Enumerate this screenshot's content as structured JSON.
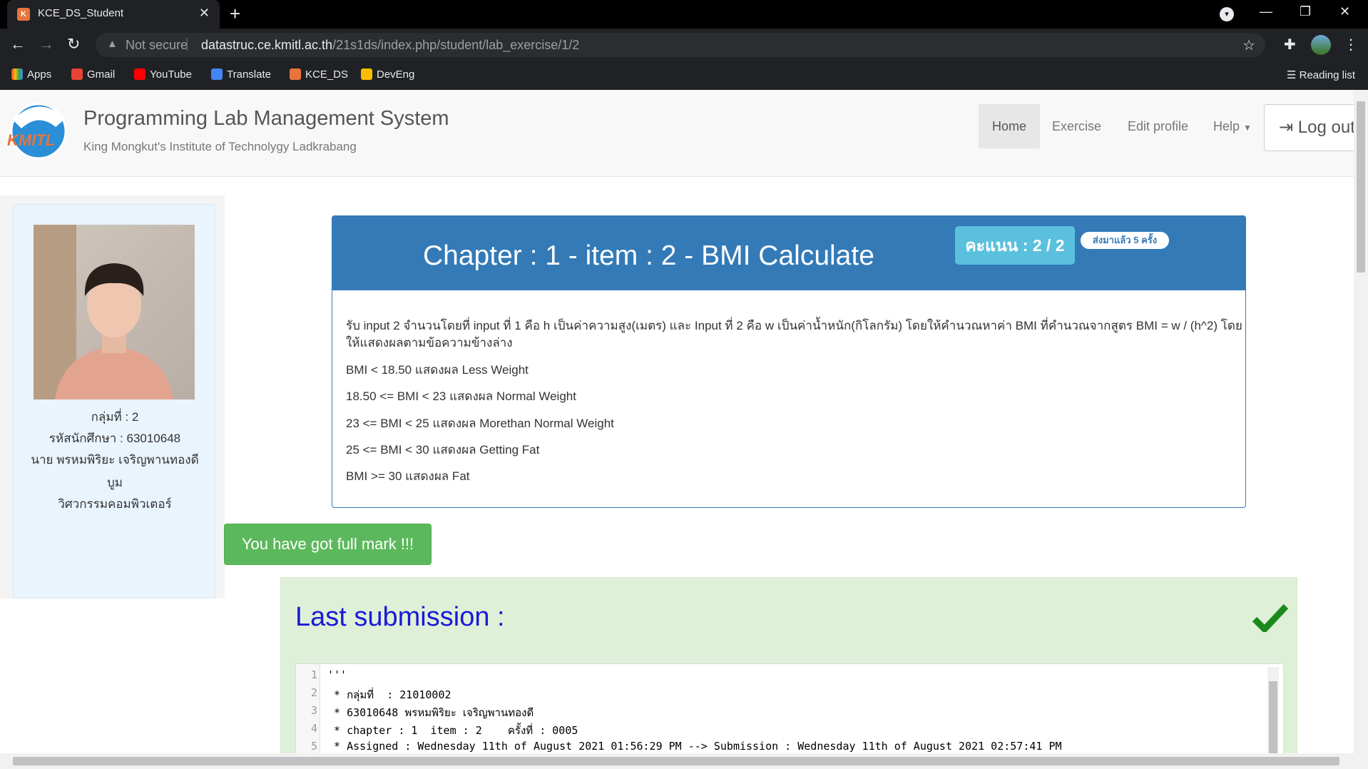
{
  "browser": {
    "tab_title": "KCE_DS_Student",
    "tab_favicon_text": "K",
    "url_security": "Not secure",
    "url_host": "datastruc.ce.kmitl.ac.th",
    "url_path": "/21s1ds/index.php/student/lab_exercise/1/2",
    "bookmarks": [
      {
        "label": "Apps",
        "color": "#ea4335"
      },
      {
        "label": "Gmail",
        "color": "#ea4335"
      },
      {
        "label": "YouTube",
        "color": "#ff0000"
      },
      {
        "label": "Translate",
        "color": "#4285f4"
      },
      {
        "label": "KCE_DS",
        "color": "#e8743b"
      },
      {
        "label": "DevEng",
        "color": "#fbbc04"
      }
    ],
    "reading_list": "Reading list"
  },
  "header": {
    "title": "Programming Lab Management System",
    "subtitle": "King Mongkut's Institute of Technolygy Ladkrabang",
    "logo_text": "KMITL",
    "nav": [
      "Home",
      "Exercise",
      "Edit profile",
      "Help"
    ],
    "logout": "Log out"
  },
  "student": {
    "group": "กลุ่มที่ : 2",
    "student_id": "รหัสนักศึกษา : 63010648",
    "name_line1": "นาย พรหมพิริยะ เจริญพานทองดี",
    "name_line2": "บูม",
    "faculty": "วิศวกรรมคอมพิวเตอร์"
  },
  "problem": {
    "title": "Chapter : 1 - item : 2 - BMI Calculate",
    "score": "คะแนน : 2 / 2",
    "submit_count": "ส่งมาแล้ว 5 ครั้ง",
    "desc_line1": "รับ input 2 จำนวนโดยที่ input ที่ 1 คือ h เป็นค่าความสูง(เมตร) และ Input ที่ 2 คือ w เป็นค่าน้ำหนัก(กิโลกรัม) โดยให้คำนวณหาค่า BMI ที่คำนวณจากสูตร BMI = w / (h^2) โดย",
    "desc_line2": "ให้แสดงผลตามข้อความข้างล่าง",
    "rules": [
      "BMI < 18.50 แสดงผล Less Weight",
      "18.50 <= BMI  < 23 แสดงผล Normal Weight",
      "23 <= BMI  < 25 แสดงผล Morethan Normal Weight",
      "25 <= BMI  < 30 แสดงผล Getting Fat",
      "BMI  >= 30 แสดงผล Fat"
    ]
  },
  "result": {
    "full_mark": "You have got full mark !!!"
  },
  "submission": {
    "title": "Last submission :",
    "lines": [
      {
        "n": "1",
        "text": "'''"
      },
      {
        "n": "2",
        "text": " * กลุ่มที่  : 21010002"
      },
      {
        "n": "3",
        "text": " * 63010648 พรหมพิริยะ เจริญพานทองดี"
      },
      {
        "n": "4",
        "text": " * chapter : 1  item : 2    ครั้งที่ : 0005"
      },
      {
        "n": "5",
        "text": " * Assigned : Wednesday 11th of August 2021 01:56:29 PM --> Submission : Wednesday 11th of August 2021 02:57:41 PM"
      }
    ]
  }
}
